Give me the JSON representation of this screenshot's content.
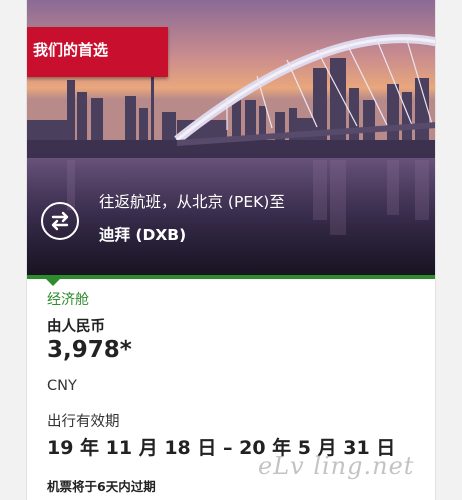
{
  "badge": {
    "label": "我们的首选"
  },
  "hero": {
    "icon": "round-trip-arrows-icon",
    "route_line1": "往返航班，从北京 (PEK)至",
    "route_line2": "迪拜 (DXB)"
  },
  "fare": {
    "cabin": "经济舱",
    "from_label": "由人民币",
    "price": "3,978*",
    "currency": "CNY",
    "validity_label": "出行有效期",
    "validity_dates": "19 年 11 月 18 日 – 20 年 5 月 31 日",
    "expiry_note": "机票将于6天内过期"
  },
  "watermark": "eLv ling.net",
  "colors": {
    "badge_red": "#c8102e",
    "accent_green": "#2e8b2e"
  }
}
